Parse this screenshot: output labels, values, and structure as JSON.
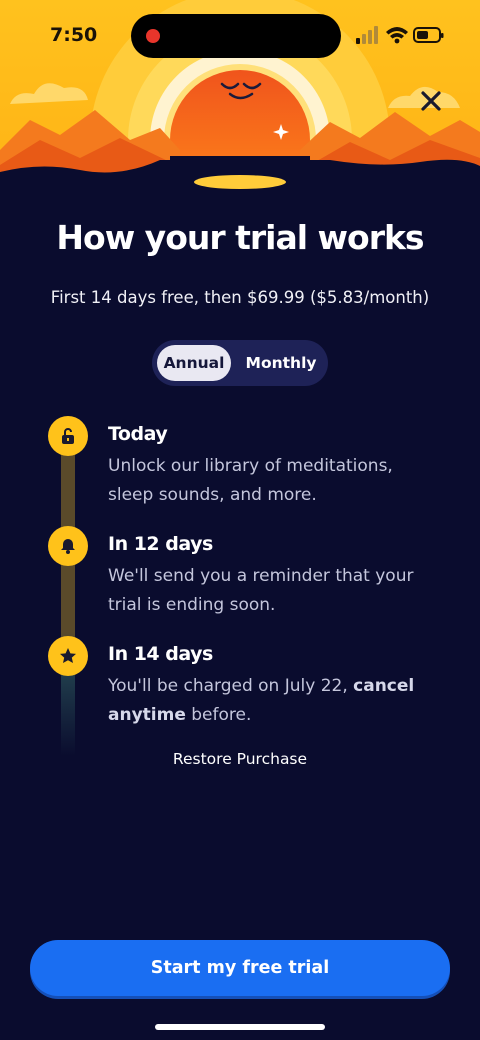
{
  "status_bar": {
    "time": "7:50"
  },
  "paywall": {
    "title": "How your trial works",
    "subtitle": "First 14 days free, then $69.99 ($5.83/month)",
    "toggle": {
      "annual": "Annual",
      "monthly": "Monthly",
      "selected": "Annual"
    },
    "steps": [
      {
        "icon": "unlock-icon",
        "title": "Today",
        "description": "Unlock our library of meditations, sleep sounds, and more."
      },
      {
        "icon": "bell-icon",
        "title": "In 12 days",
        "description": "We'll send you a reminder that your trial is ending soon."
      },
      {
        "icon": "star-icon",
        "title": "In 14 days",
        "description_before": "You'll be charged on July 22, ",
        "description_bold": "cancel anytime",
        "description_after": " before."
      }
    ],
    "restore_label": "Restore Purchase",
    "cta_label": "Start my free trial"
  },
  "colors": {
    "background": "#0a0c2e",
    "accent": "#1a6ef2",
    "step_icon": "#ffc21a",
    "sun": "#f26a1e"
  }
}
